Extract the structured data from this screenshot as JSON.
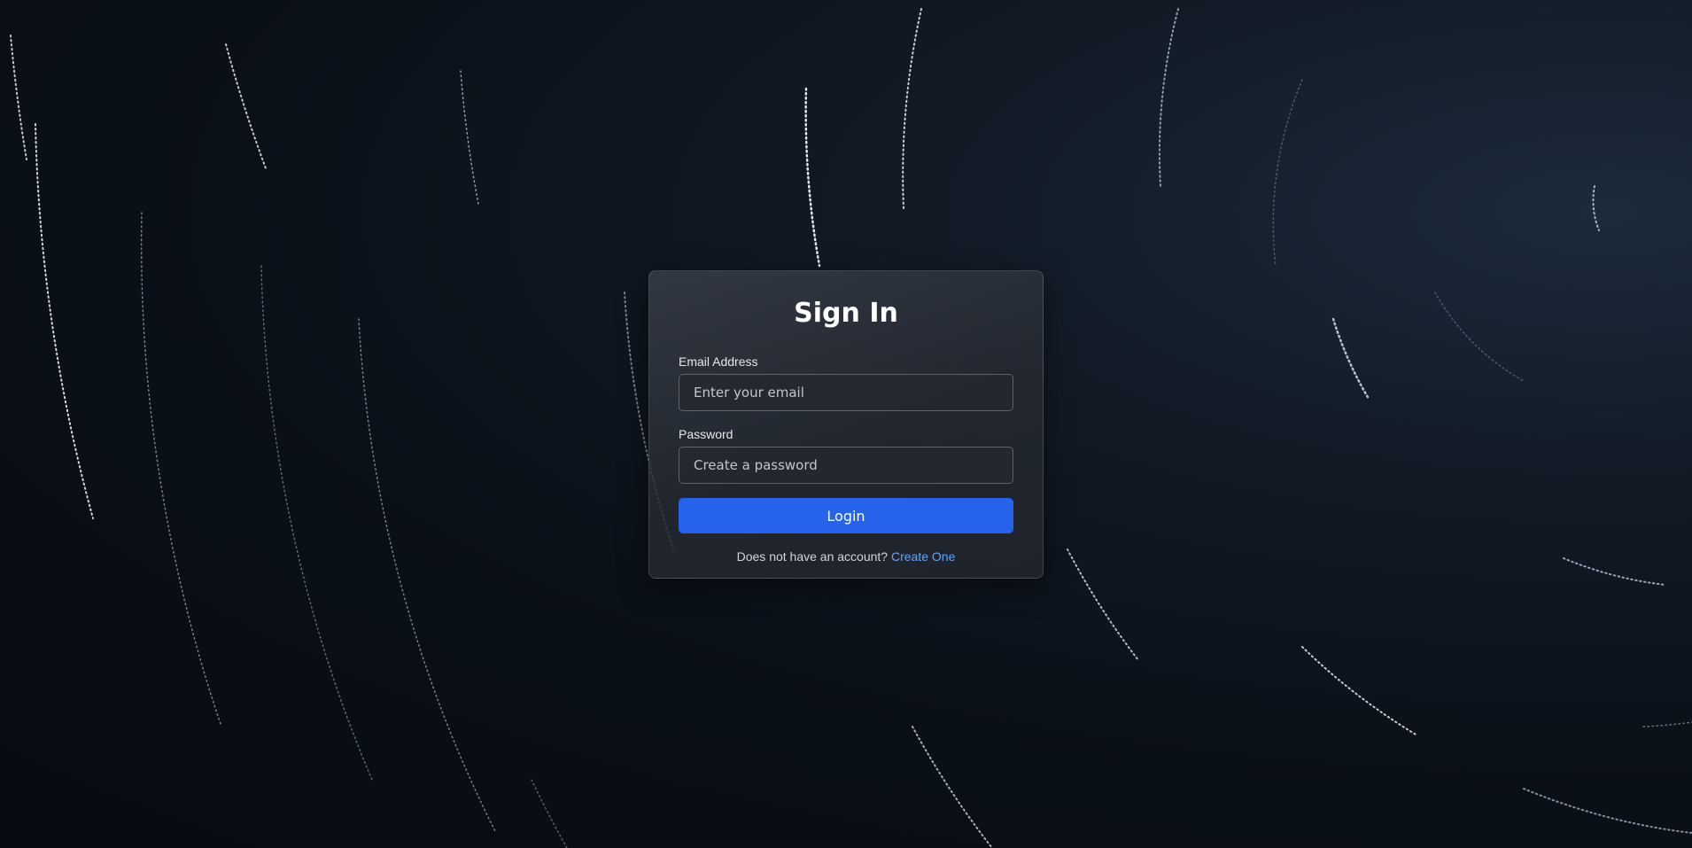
{
  "form": {
    "title": "Sign In",
    "email_label": "Email Address",
    "email_placeholder": "Enter your email",
    "email_value": "",
    "password_label": "Password",
    "password_placeholder": "Create a password",
    "password_value": "",
    "login_label": "Login",
    "footer_text": "Does not have an account?",
    "create_link": "Create One"
  },
  "colors": {
    "accent": "#2563eb",
    "link": "#60a5fa",
    "background": "#0b1119"
  }
}
